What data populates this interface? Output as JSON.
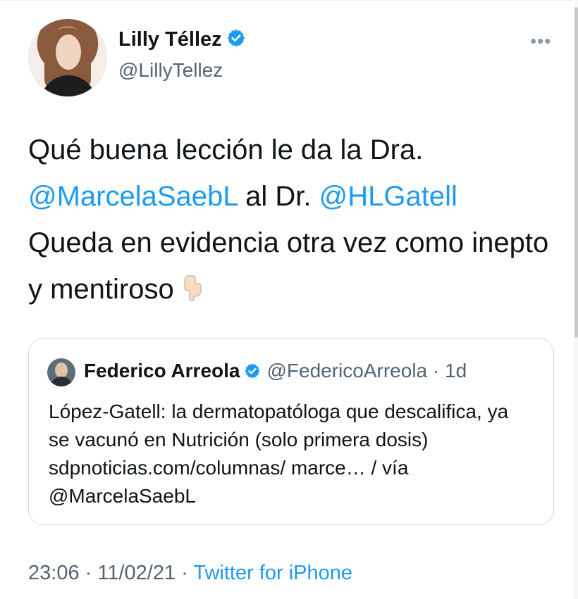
{
  "tweet": {
    "author_name": "Lilly Téllez",
    "author_handle": "@LillyTellez",
    "more_icon": "more-dots-icon",
    "text_1": "Qué buena lección le da la Dra.",
    "mention_1": "@MarcelaSaebL",
    "text_2": " al Dr. ",
    "mention_2": "@HLGatell",
    "text_3": "Queda en evidencia otra vez como inepto y mentiroso",
    "emoji_icon": "pointing-down-hand-icon"
  },
  "quote": {
    "author_name": "Federico Arreola",
    "author_handle": "@FedericoArreola",
    "time": "1d",
    "text": "López-Gatell: la dermatopatóloga que descalifica, ya se vacunó en Nutrición (solo primera dosis) sdpnoticias.com/columnas/ marce… / vía @MarcelaSaebL"
  },
  "footer": {
    "time": "23:06",
    "date": "11/02/21",
    "source": "Twitter for iPhone"
  },
  "colors": {
    "accent": "#1d9bf0",
    "text": "#0f1419",
    "muted": "#536471"
  }
}
